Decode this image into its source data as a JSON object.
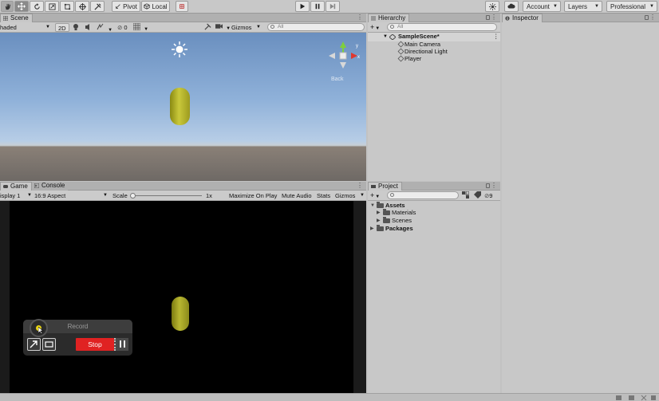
{
  "toolbar": {
    "pivot_label": "Pivot",
    "local_label": "Local",
    "account_label": "Account",
    "layers_label": "Layers",
    "layout_label": "Professional"
  },
  "scene": {
    "tab_label": "Scene",
    "shading_label": "haded",
    "mode_2d_label": "2D",
    "hidden_count": "0",
    "gizmos_label": "Gizmos",
    "search_placeholder": "All",
    "view_label": "Back"
  },
  "game": {
    "tab_label": "Game",
    "console_tab_label": "Console",
    "display_label": "isplay 1",
    "aspect_label": "16:9 Aspect",
    "scale_label": "Scale",
    "scale_value": "1x",
    "maximize_label": "Maximize On Play",
    "mute_label": "Mute Audio",
    "stats_label": "Stats",
    "gizmos_label": "Gizmos"
  },
  "hierarchy": {
    "tab_label": "Hierarchy",
    "search_placeholder": "All",
    "scene_name": "SampleScene*",
    "items": [
      {
        "label": "Main Camera"
      },
      {
        "label": "Directional Light"
      },
      {
        "label": "Player"
      }
    ]
  },
  "project": {
    "tab_label": "Project",
    "hidden_count": "9",
    "assets_label": "Assets",
    "materials_label": "Materials",
    "scenes_label": "Scenes",
    "packages_label": "Packages"
  },
  "inspector": {
    "tab_label": "Inspector"
  },
  "recorder": {
    "title": "Record",
    "stop_label": "Stop"
  },
  "colors": {
    "stop_button": "#e02222",
    "capsule": "#c9c83a",
    "sky": "#8fb1d9"
  }
}
